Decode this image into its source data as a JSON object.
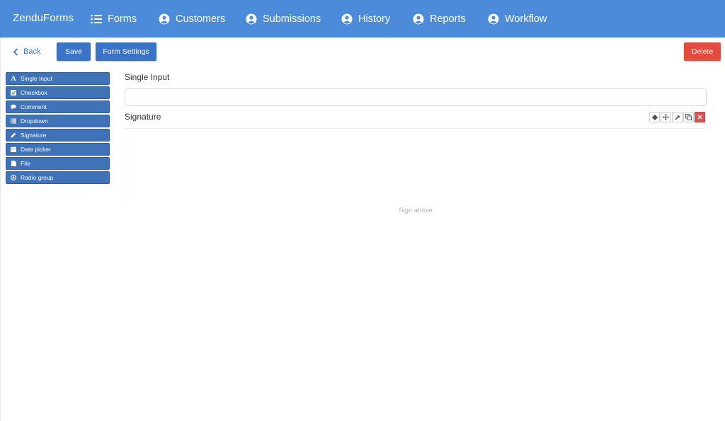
{
  "app": {
    "brand": "ZenduForms"
  },
  "nav": {
    "forms": "Forms",
    "customers": "Customers",
    "submissions": "Submissions",
    "history": "History",
    "reports": "Reports",
    "workflow": "Workflow"
  },
  "toolbar": {
    "back": "Back",
    "save": "Save",
    "form_settings": "Form Settings",
    "delete": "Delete"
  },
  "palette": {
    "items": [
      {
        "label": "Single Input",
        "icon": "text-a-icon"
      },
      {
        "label": "Checkbox",
        "icon": "checkbox-icon"
      },
      {
        "label": "Comment",
        "icon": "comment-icon"
      },
      {
        "label": "Dropdown",
        "icon": "list-icon"
      },
      {
        "label": "Signature",
        "icon": "pencil-icon"
      },
      {
        "label": "Date picker",
        "icon": "calendar-icon"
      },
      {
        "label": "File",
        "icon": "file-icon"
      },
      {
        "label": "Radio group",
        "icon": "radio-icon"
      }
    ]
  },
  "form": {
    "single_input": {
      "label": "Single Input",
      "value": ""
    },
    "signature": {
      "label": "Signature",
      "hint": "Sign above"
    }
  },
  "colors": {
    "nav_bg": "#4c8bd9",
    "primary": "#3a73c8",
    "palette": "#3f72b7",
    "danger": "#e24b3d"
  }
}
